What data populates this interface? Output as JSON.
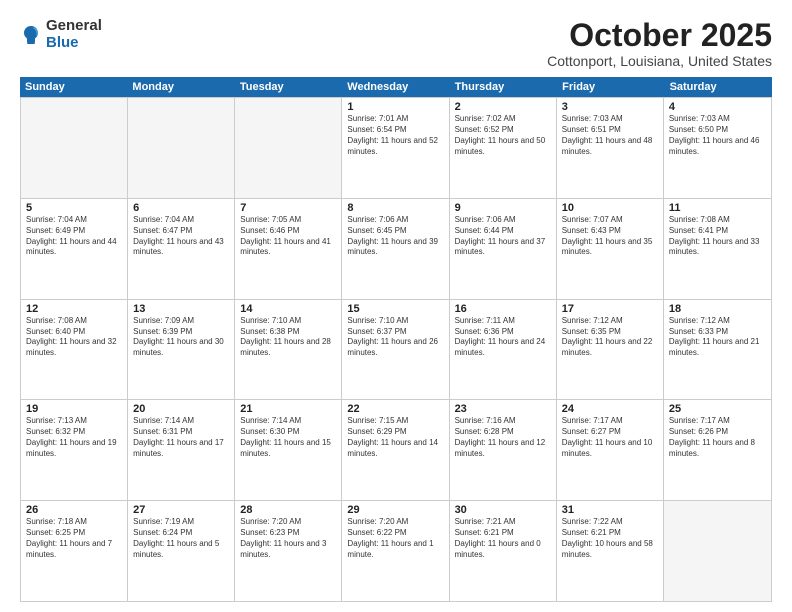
{
  "logo": {
    "general": "General",
    "blue": "Blue"
  },
  "title": "October 2025",
  "location": "Cottonport, Louisiana, United States",
  "weekdays": [
    "Sunday",
    "Monday",
    "Tuesday",
    "Wednesday",
    "Thursday",
    "Friday",
    "Saturday"
  ],
  "rows": [
    [
      {
        "day": "",
        "info": "",
        "empty": true
      },
      {
        "day": "",
        "info": "",
        "empty": true
      },
      {
        "day": "",
        "info": "",
        "empty": true
      },
      {
        "day": "1",
        "info": "Sunrise: 7:01 AM\nSunset: 6:54 PM\nDaylight: 11 hours and 52 minutes."
      },
      {
        "day": "2",
        "info": "Sunrise: 7:02 AM\nSunset: 6:52 PM\nDaylight: 11 hours and 50 minutes."
      },
      {
        "day": "3",
        "info": "Sunrise: 7:03 AM\nSunset: 6:51 PM\nDaylight: 11 hours and 48 minutes."
      },
      {
        "day": "4",
        "info": "Sunrise: 7:03 AM\nSunset: 6:50 PM\nDaylight: 11 hours and 46 minutes."
      }
    ],
    [
      {
        "day": "5",
        "info": "Sunrise: 7:04 AM\nSunset: 6:49 PM\nDaylight: 11 hours and 44 minutes."
      },
      {
        "day": "6",
        "info": "Sunrise: 7:04 AM\nSunset: 6:47 PM\nDaylight: 11 hours and 43 minutes."
      },
      {
        "day": "7",
        "info": "Sunrise: 7:05 AM\nSunset: 6:46 PM\nDaylight: 11 hours and 41 minutes."
      },
      {
        "day": "8",
        "info": "Sunrise: 7:06 AM\nSunset: 6:45 PM\nDaylight: 11 hours and 39 minutes."
      },
      {
        "day": "9",
        "info": "Sunrise: 7:06 AM\nSunset: 6:44 PM\nDaylight: 11 hours and 37 minutes."
      },
      {
        "day": "10",
        "info": "Sunrise: 7:07 AM\nSunset: 6:43 PM\nDaylight: 11 hours and 35 minutes."
      },
      {
        "day": "11",
        "info": "Sunrise: 7:08 AM\nSunset: 6:41 PM\nDaylight: 11 hours and 33 minutes."
      }
    ],
    [
      {
        "day": "12",
        "info": "Sunrise: 7:08 AM\nSunset: 6:40 PM\nDaylight: 11 hours and 32 minutes."
      },
      {
        "day": "13",
        "info": "Sunrise: 7:09 AM\nSunset: 6:39 PM\nDaylight: 11 hours and 30 minutes."
      },
      {
        "day": "14",
        "info": "Sunrise: 7:10 AM\nSunset: 6:38 PM\nDaylight: 11 hours and 28 minutes."
      },
      {
        "day": "15",
        "info": "Sunrise: 7:10 AM\nSunset: 6:37 PM\nDaylight: 11 hours and 26 minutes."
      },
      {
        "day": "16",
        "info": "Sunrise: 7:11 AM\nSunset: 6:36 PM\nDaylight: 11 hours and 24 minutes."
      },
      {
        "day": "17",
        "info": "Sunrise: 7:12 AM\nSunset: 6:35 PM\nDaylight: 11 hours and 22 minutes."
      },
      {
        "day": "18",
        "info": "Sunrise: 7:12 AM\nSunset: 6:33 PM\nDaylight: 11 hours and 21 minutes."
      }
    ],
    [
      {
        "day": "19",
        "info": "Sunrise: 7:13 AM\nSunset: 6:32 PM\nDaylight: 11 hours and 19 minutes."
      },
      {
        "day": "20",
        "info": "Sunrise: 7:14 AM\nSunset: 6:31 PM\nDaylight: 11 hours and 17 minutes."
      },
      {
        "day": "21",
        "info": "Sunrise: 7:14 AM\nSunset: 6:30 PM\nDaylight: 11 hours and 15 minutes."
      },
      {
        "day": "22",
        "info": "Sunrise: 7:15 AM\nSunset: 6:29 PM\nDaylight: 11 hours and 14 minutes."
      },
      {
        "day": "23",
        "info": "Sunrise: 7:16 AM\nSunset: 6:28 PM\nDaylight: 11 hours and 12 minutes."
      },
      {
        "day": "24",
        "info": "Sunrise: 7:17 AM\nSunset: 6:27 PM\nDaylight: 11 hours and 10 minutes."
      },
      {
        "day": "25",
        "info": "Sunrise: 7:17 AM\nSunset: 6:26 PM\nDaylight: 11 hours and 8 minutes."
      }
    ],
    [
      {
        "day": "26",
        "info": "Sunrise: 7:18 AM\nSunset: 6:25 PM\nDaylight: 11 hours and 7 minutes."
      },
      {
        "day": "27",
        "info": "Sunrise: 7:19 AM\nSunset: 6:24 PM\nDaylight: 11 hours and 5 minutes."
      },
      {
        "day": "28",
        "info": "Sunrise: 7:20 AM\nSunset: 6:23 PM\nDaylight: 11 hours and 3 minutes."
      },
      {
        "day": "29",
        "info": "Sunrise: 7:20 AM\nSunset: 6:22 PM\nDaylight: 11 hours and 1 minute."
      },
      {
        "day": "30",
        "info": "Sunrise: 7:21 AM\nSunset: 6:21 PM\nDaylight: 11 hours and 0 minutes."
      },
      {
        "day": "31",
        "info": "Sunrise: 7:22 AM\nSunset: 6:21 PM\nDaylight: 10 hours and 58 minutes."
      },
      {
        "day": "",
        "info": "",
        "empty": true
      }
    ]
  ]
}
